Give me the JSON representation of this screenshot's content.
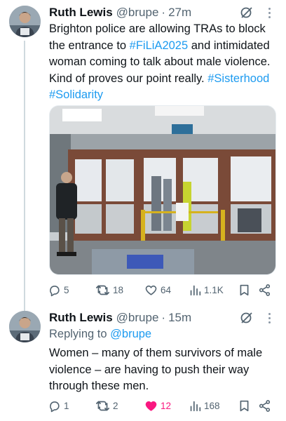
{
  "tweets": [
    {
      "author": {
        "name": "Ruth Lewis",
        "handle": "@brupe"
      },
      "time": "27m",
      "text_parts": {
        "t1": "Brighton police are allowing TRAs to block the entrance to ",
        "tag1": "#FiLiA2025",
        "t2": " and intimidated woman coming to talk about male violence. Kind of proves our point really. ",
        "tag2": "#Sisterhood",
        "t3": " ",
        "tag3": "#Solidarity"
      },
      "stats": {
        "replies": "5",
        "retweets": "18",
        "likes": "64",
        "views": "1.1K"
      },
      "liked": false
    },
    {
      "author": {
        "name": "Ruth Lewis",
        "handle": "@brupe"
      },
      "time": "15m",
      "replying_label": "Replying to",
      "replying_to": "@brupe",
      "text": "Women – many of them survivors of male violence – are having to push their way through these men.",
      "stats": {
        "replies": "1",
        "retweets": "2",
        "likes": "12",
        "views": "168"
      },
      "liked": true
    }
  ],
  "colors": {
    "link": "#1d9bf0",
    "like_active": "#f91880",
    "secondary_text": "#536471",
    "thread_line": "#cfd9de"
  },
  "icons": [
    "grok-icon",
    "more-icon",
    "reply-icon",
    "retweet-icon",
    "like-icon",
    "views-icon",
    "bookmark-icon",
    "share-icon"
  ]
}
